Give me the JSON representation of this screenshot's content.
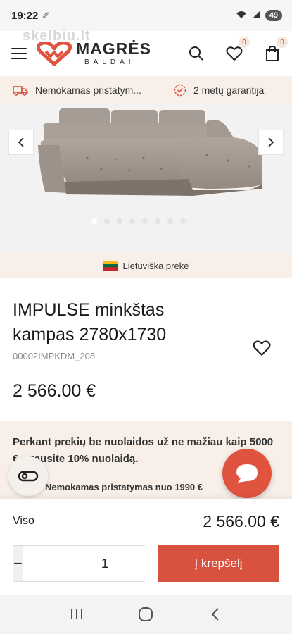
{
  "status_bar": {
    "time": "19:22",
    "battery": "49"
  },
  "header": {
    "watermark": "skelbiu.lt",
    "logo_main": "MAGRĖS",
    "logo_sub": "BALDAI",
    "wishlist_count": "0",
    "cart_count": "0"
  },
  "info_strip": {
    "delivery": "Nemokamas pristatym...",
    "warranty": "2 metų garantija"
  },
  "gallery": {
    "prev_label": "‹",
    "next_label": "›",
    "dots": 8,
    "active_dot": 0
  },
  "origin": {
    "label": "Lietuviška prekė",
    "flag_colors": [
      "#fdb913",
      "#006a44",
      "#c1272d"
    ]
  },
  "product": {
    "title": "IMPULSE minkštas kampas 2780x1730",
    "sku": "00002IMPKDM_208",
    "price": "2 566.00 €"
  },
  "promo": {
    "text": "Perkant prekių be nuolaidos už ne mažiau kaip 5000 € - gausite 10% nuolaidą.",
    "sub": "Nemokamas pristatymas nuo 1990 €"
  },
  "cart": {
    "total_label": "Viso",
    "total_value": "2 566.00 €",
    "minus": "−",
    "quantity": "1",
    "plus": "+",
    "add_label": "Į krepšelį"
  },
  "colors": {
    "accent": "#d9513f",
    "cream": "#f7efe8"
  }
}
